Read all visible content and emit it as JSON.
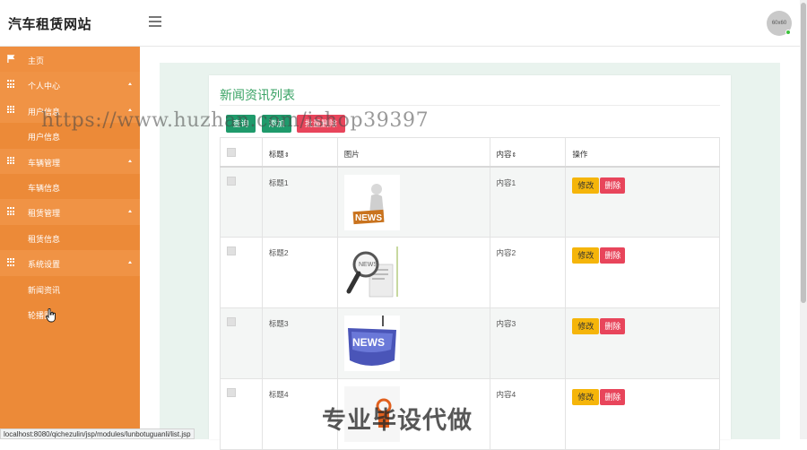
{
  "app": {
    "brand": "汽车租赁网站",
    "avatar_text": "60x60"
  },
  "sidebar": {
    "items": [
      {
        "label": "主页",
        "type": "home",
        "icon": "flag-icon"
      },
      {
        "label": "个人中心",
        "type": "group",
        "icon": "grid-icon"
      },
      {
        "label": "用户信息",
        "type": "group",
        "icon": "grid-icon"
      },
      {
        "label": "用户信息",
        "type": "sub"
      },
      {
        "label": "车辆管理",
        "type": "group",
        "icon": "grid-icon"
      },
      {
        "label": "车辆信息",
        "type": "sub"
      },
      {
        "label": "租赁管理",
        "type": "group",
        "icon": "grid-icon"
      },
      {
        "label": "租赁信息",
        "type": "sub"
      },
      {
        "label": "系统设置",
        "type": "group",
        "icon": "grid-icon"
      },
      {
        "label": "新闻资讯",
        "type": "sub"
      },
      {
        "label": "轮播图",
        "type": "sub"
      }
    ]
  },
  "main": {
    "title": "新闻资讯列表",
    "toolbar": {
      "search_label": "查询",
      "add_label": "添加",
      "batch_delete_label": "批量删除"
    },
    "table": {
      "headers": {
        "title": "标题",
        "image": "图片",
        "content": "内容",
        "actions": "操作"
      },
      "sort_glyph": "⇕",
      "rows": [
        {
          "title": "标题1",
          "content": "内容1",
          "image": "news-figure-image"
        },
        {
          "title": "标题2",
          "content": "内容2",
          "image": "magnifier-newspaper-image"
        },
        {
          "title": "标题3",
          "content": "内容3",
          "image": "news-key-image"
        },
        {
          "title": "标题4",
          "content": "内容4",
          "image": "news-graphic-image"
        }
      ],
      "edit_label": "修改",
      "delete_label": "删除"
    }
  },
  "status_bar": {
    "url": "localhost:8080/qichezulin/jsp/modules/lunbotuguanli/list.jsp"
  },
  "watermarks": {
    "top": "https://www.huzhan.com/ishop39397",
    "bottom": "专业毕设代做"
  },
  "colors": {
    "sidebar": "#ec8a38",
    "accent_green": "#3aa365",
    "button_green": "#1f9a6b",
    "danger": "#e8455b",
    "warning": "#f5b50a"
  }
}
